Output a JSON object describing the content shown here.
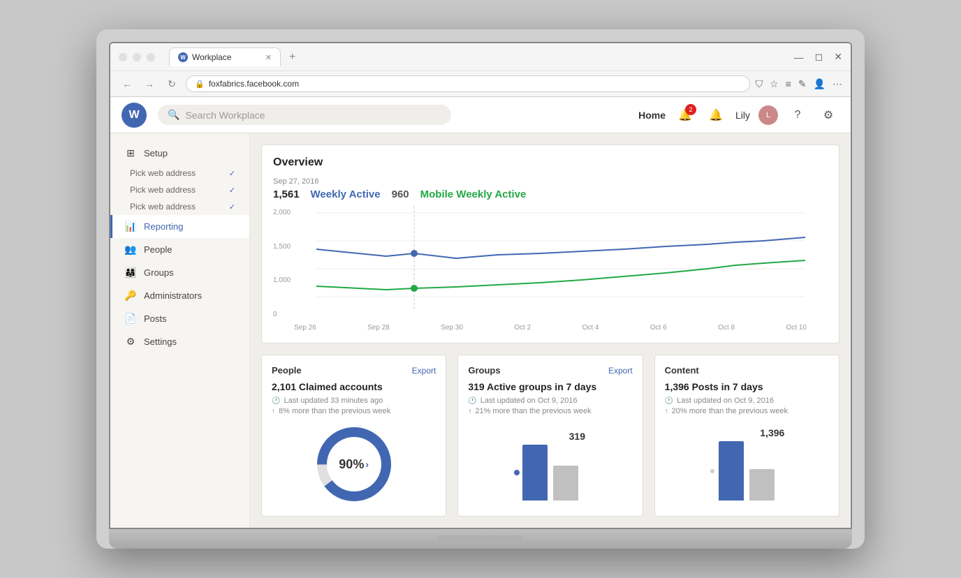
{
  "browser": {
    "tab_title": "Workplace",
    "tab_new": "+",
    "address": "foxfabrics.facebook.com",
    "nav_back": "←",
    "nav_forward": "→",
    "nav_refresh": "↻"
  },
  "app": {
    "logo_letter": "W",
    "search_placeholder": "Search Workplace",
    "header": {
      "nav_home": "Home",
      "notification_count": "2",
      "user_name": "Lily"
    }
  },
  "sidebar": {
    "setup_label": "Setup",
    "items": [
      {
        "id": "pick1",
        "label": "Pick web address",
        "checked": true
      },
      {
        "id": "pick2",
        "label": "Pick web address",
        "checked": true
      },
      {
        "id": "pick3",
        "label": "Pick web address",
        "checked": true
      },
      {
        "id": "reporting",
        "label": "Reporting",
        "active": true,
        "icon": "📊"
      },
      {
        "id": "people",
        "label": "People",
        "icon": "👥"
      },
      {
        "id": "groups",
        "label": "Groups",
        "icon": "👨‍👩‍👧"
      },
      {
        "id": "administrators",
        "label": "Administrators",
        "icon": "🔑"
      },
      {
        "id": "posts",
        "label": "Posts",
        "icon": "📄"
      },
      {
        "id": "settings",
        "label": "Settings",
        "icon": "⚙"
      }
    ]
  },
  "overview": {
    "title": "Overview",
    "date": "Sep 27, 2016",
    "weekly_active_num": "1,561",
    "weekly_active_label": "Weekly Active",
    "mobile_num": "960",
    "mobile_label": "Mobile Weekly Active",
    "chart": {
      "y_labels": [
        "2,000",
        "1,500",
        "1,000",
        "0"
      ],
      "x_labels": [
        "Sep 26",
        "Sep 28",
        "Sep 30",
        "Oct 2",
        "Oct 4",
        "Oct 6",
        "Oct 8",
        "Oct 10"
      ]
    }
  },
  "people_card": {
    "title": "People",
    "export_label": "Export",
    "main_stat": "2,101 Claimed accounts",
    "last_updated": "Last updated 33 minutes ago",
    "change": "8% more than the previous week",
    "donut_percent": "90%",
    "donut_blue_pct": 90,
    "donut_gray_pct": 10
  },
  "groups_card": {
    "title": "Groups",
    "export_label": "Export",
    "main_stat": "319 Active groups in 7 days",
    "last_updated": "Last updated on Oct 9, 2016",
    "change": "21% more than the previous week",
    "bar_value": "319",
    "bar_blue_height": 80,
    "bar_gray_height": 50
  },
  "content_card": {
    "title": "Content",
    "main_stat": "1,396 Posts in 7 days",
    "last_updated": "Last updated on Oct 9, 2016",
    "change": "20% more than the previous week",
    "bar_value": "1,396",
    "bar_blue_height": 85,
    "bar_gray_height": 45
  }
}
